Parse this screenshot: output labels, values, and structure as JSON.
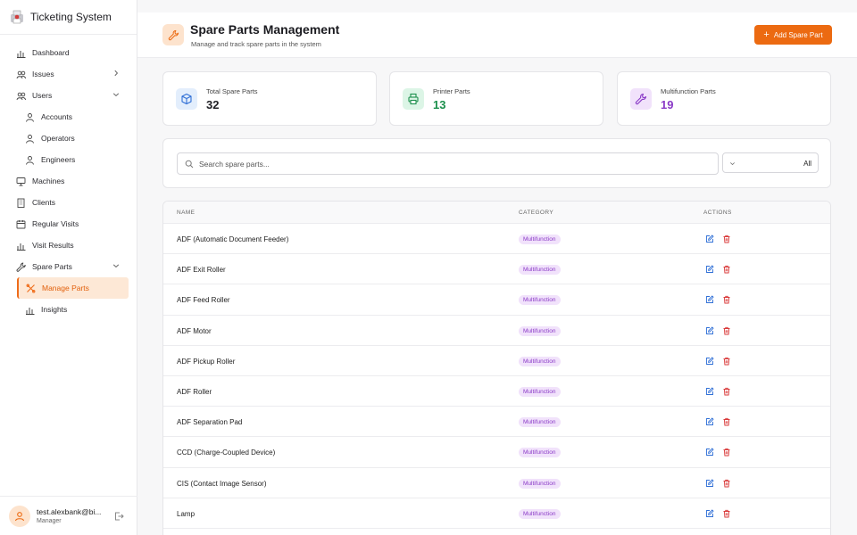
{
  "app": {
    "title": "Ticketing System"
  },
  "sidebar": {
    "items": [
      {
        "label": "Dashboard",
        "icon": "chart-bar-icon",
        "level": "top"
      },
      {
        "label": "Issues",
        "icon": "issues-icon",
        "level": "top",
        "chevron": "right"
      },
      {
        "label": "Users",
        "icon": "users-icon",
        "level": "top",
        "chevron": "down"
      },
      {
        "label": "Accounts",
        "icon": "user-icon",
        "level": "sub"
      },
      {
        "label": "Operators",
        "icon": "user-icon",
        "level": "sub"
      },
      {
        "label": "Engineers",
        "icon": "user-icon",
        "level": "sub"
      },
      {
        "label": "Machines",
        "icon": "monitor-icon",
        "level": "top"
      },
      {
        "label": "Clients",
        "icon": "building-icon",
        "level": "top"
      },
      {
        "label": "Regular Visits",
        "icon": "calendar-icon",
        "level": "top"
      },
      {
        "label": "Visit Results",
        "icon": "chart-bar-icon",
        "level": "top"
      },
      {
        "label": "Spare Parts",
        "icon": "wrench-icon",
        "level": "top",
        "chevron": "down"
      },
      {
        "label": "Manage Parts",
        "icon": "tools-icon",
        "level": "active"
      },
      {
        "label": "Insights",
        "icon": "chart-bar-icon",
        "level": "sub"
      }
    ],
    "user": {
      "email": "test.alexbank@bi...",
      "role": "Manager"
    }
  },
  "header": {
    "title": "Spare Parts Management",
    "subtitle": "Manage and track spare parts in the system",
    "add_label": "Add Spare Part"
  },
  "stats": [
    {
      "label": "Total Spare Parts",
      "value": "32",
      "color": "#1f1f24",
      "bg": "#e3eefc",
      "icon": "package-icon",
      "iconColor": "#2f6fd6"
    },
    {
      "label": "Printer Parts",
      "value": "13",
      "color": "#1b8f4c",
      "bg": "#dcf5e6",
      "icon": "printer-icon",
      "iconColor": "#1b8f4c"
    },
    {
      "label": "Multifunction Parts",
      "value": "19",
      "color": "#8a3ac7",
      "bg": "#f1e2fb",
      "icon": "wrench-icon",
      "iconColor": "#8a3ac7"
    }
  ],
  "search": {
    "placeholder": "Search spare parts...",
    "filter_value": "All"
  },
  "table": {
    "columns": [
      "NAME",
      "CATEGORY",
      "ACTIONS"
    ],
    "rows": [
      {
        "name": "ADF (Automatic Document Feeder)",
        "category": "Multifunction"
      },
      {
        "name": "ADF Exit Roller",
        "category": "Multifunction"
      },
      {
        "name": "ADF Feed Roller",
        "category": "Multifunction"
      },
      {
        "name": "ADF Motor",
        "category": "Multifunction"
      },
      {
        "name": "ADF Pickup Roller",
        "category": "Multifunction"
      },
      {
        "name": "ADF Roller",
        "category": "Multifunction"
      },
      {
        "name": "ADF Separation Pad",
        "category": "Multifunction"
      },
      {
        "name": "CCD (Charge-Coupled Device)",
        "category": "Multifunction"
      },
      {
        "name": "CIS (Contact Image Sensor)",
        "category": "Multifunction"
      },
      {
        "name": "Lamp",
        "category": "Multifunction"
      }
    ]
  },
  "colors": {
    "accent": "#ec6a11",
    "edit": "#2f6fd6",
    "delete": "#d93a3a"
  }
}
